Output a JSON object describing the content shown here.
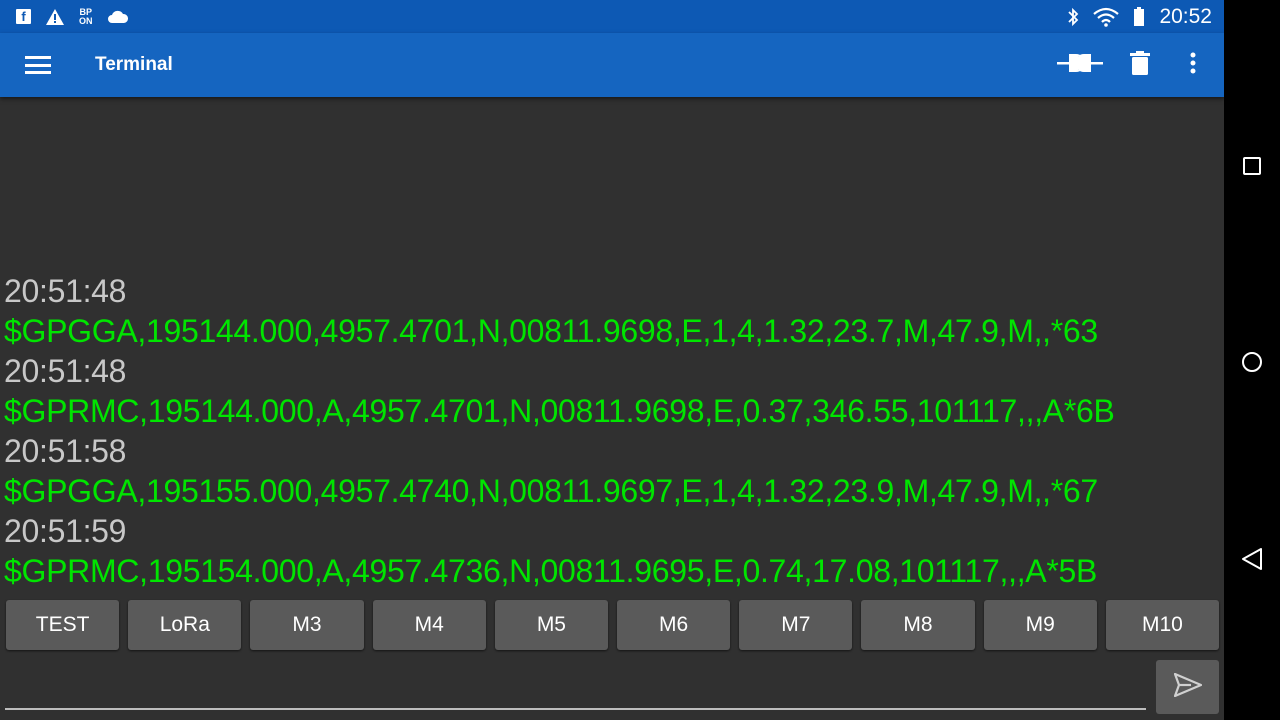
{
  "status_bar": {
    "left_icons": [
      "facebook-icon",
      "warning-icon",
      "bp-on-icon",
      "cloud-icon"
    ],
    "bp_top": "BP",
    "bp_bottom": "ON",
    "right_icons": [
      "bluetooth-icon",
      "wifi-icon",
      "battery-icon"
    ],
    "time": "20:52"
  },
  "app_bar": {
    "title": "Terminal",
    "actions": [
      "connect-icon",
      "delete-icon",
      "more-vert-icon"
    ]
  },
  "terminal": {
    "lines": [
      {
        "time": "20:51:48",
        "text": "$GPGGA,195144.000,4957.4701,N,00811.9698,E,1,4,1.32,23.7,M,47.9,M,,*63"
      },
      {
        "time": "20:51:48",
        "text": "$GPRMC,195144.000,A,4957.4701,N,00811.9698,E,0.37,346.55,101117,,,A*6B"
      },
      {
        "time": "20:51:58",
        "text": "$GPGGA,195155.000,4957.4740,N,00811.9697,E,1,4,1.32,23.9,M,47.9,M,,*67"
      },
      {
        "time": "20:51:59",
        "text": "$GPRMC,195154.000,A,4957.4736,N,00811.9695,E,0.74,17.08,101117,,,A*5B"
      }
    ],
    "time_color": "#c8c8c8",
    "text_color": "#00e500"
  },
  "macros": [
    "TEST",
    "LoRa",
    "M3",
    "M4",
    "M5",
    "M6",
    "M7",
    "M8",
    "M9",
    "M10"
  ],
  "input": {
    "value": "",
    "placeholder": ""
  },
  "send_button": {
    "icon": "send-icon"
  },
  "nav_bar": {
    "buttons": [
      "recents-icon",
      "home-icon",
      "back-icon"
    ]
  },
  "colors": {
    "status_bar": "#0d59b4",
    "app_bar": "#1565c0",
    "terminal_bg": "#303030",
    "button_bg": "#5a5a5a"
  }
}
